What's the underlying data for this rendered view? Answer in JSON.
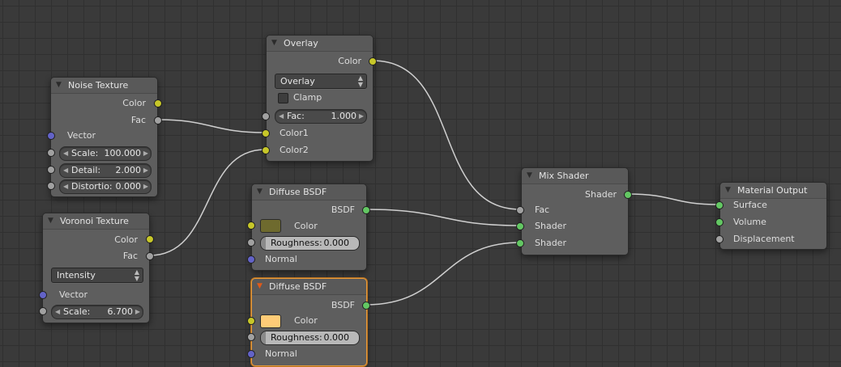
{
  "colors": {
    "link": "#cfcfcf",
    "socket_color": "#c7c729",
    "socket_shader": "#63c763",
    "socket_vector": "#6363c7",
    "socket_value": "#a1a1a1",
    "selected_outline": "#e59a3c"
  },
  "nodes": {
    "noise": {
      "title": "Noise Texture",
      "out_color": "Color",
      "out_fac": "Fac",
      "in_vector": "Vector",
      "scale": {
        "label": "Scale:",
        "value": "100.000"
      },
      "detail": {
        "label": "Detail:",
        "value": "2.000"
      },
      "distortion": {
        "label": "Distortio:",
        "value": "0.000"
      }
    },
    "voronoi": {
      "title": "Voronoi Texture",
      "out_color": "Color",
      "out_fac": "Fac",
      "coloring": "Intensity",
      "in_vector": "Vector",
      "scale": {
        "label": "Scale:",
        "value": "6.700"
      }
    },
    "overlay": {
      "title": "Overlay",
      "out_color": "Color",
      "blend_mode": "Overlay",
      "clamp_label": "Clamp",
      "clamp_checked": false,
      "fac": {
        "label": "Fac:",
        "value": "1.000"
      },
      "in_color1": "Color1",
      "in_color2": "Color2"
    },
    "diffuse1": {
      "title": "Diffuse BSDF",
      "out_bsdf": "BSDF",
      "in_color": "Color",
      "swatch": "#6e6a2e",
      "roughness": {
        "label": "Roughness:",
        "value": "0.000"
      },
      "in_normal": "Normal"
    },
    "diffuse2": {
      "title": "Diffuse BSDF",
      "out_bsdf": "BSDF",
      "in_color": "Color",
      "swatch": "#ffcc77",
      "roughness": {
        "label": "Roughness:",
        "value": "0.000"
      },
      "in_normal": "Normal"
    },
    "mix": {
      "title": "Mix Shader",
      "out_shader": "Shader",
      "in_fac": "Fac",
      "in_shader1": "Shader",
      "in_shader2": "Shader"
    },
    "output": {
      "title": "Material Output",
      "in_surface": "Surface",
      "in_volume": "Volume",
      "in_displacement": "Displacement"
    }
  }
}
